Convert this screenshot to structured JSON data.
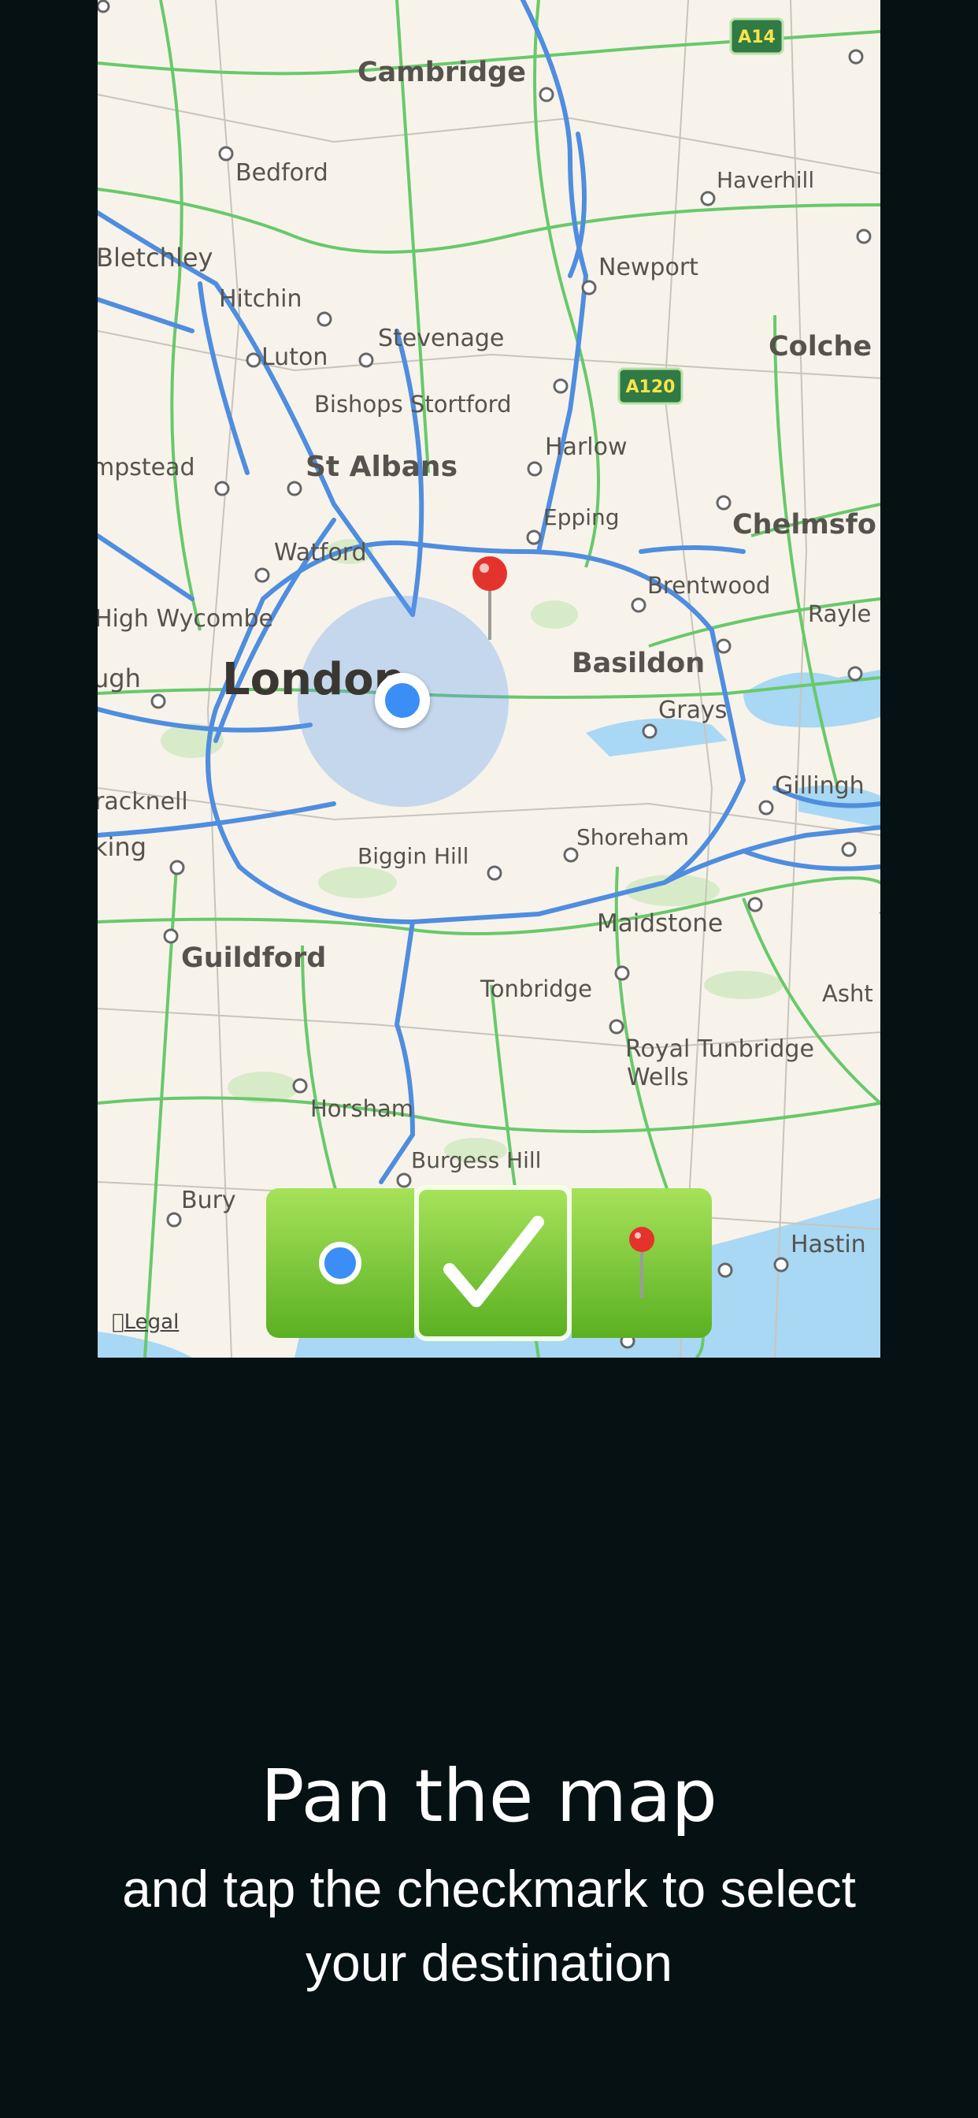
{
  "map": {
    "legal_label": "Legal",
    "cities_large": [
      "London"
    ],
    "cities_medium": [
      "Cambridge",
      "St Albans",
      "Chelmsfo",
      "Basildon",
      "Guildford",
      "Colche"
    ],
    "cities_small": [
      "Bedford",
      "Haverhill",
      "Bletchley",
      "Newport",
      "Hitchin",
      "Stevenage",
      "Luton",
      "Bishops Stortford",
      "Harlow",
      "mpstead",
      "Epping",
      "Watford",
      "Brentwood",
      "Rayle",
      "High Wycombe",
      "ugh",
      "Grays",
      "racknell",
      "Gillingh",
      "king",
      "Shoreham",
      "Biggin Hill",
      "Maidstone",
      "Tonbridge",
      "Asht",
      "Royal Tunbridge",
      "Wells",
      "Horsham",
      "Burgess Hill",
      "Bury",
      "Hastin"
    ],
    "road_shields": [
      "A14",
      "A120"
    ],
    "colors": {
      "road_motorway": "#4f8ddf",
      "road_primary": "#68c96a",
      "water": "#a8d8f4",
      "land": "#f7f3ea",
      "accuracy_circle": "#5d9af0",
      "pin": "#e4332d"
    }
  },
  "buttons": {
    "current_location_icon": "location-dot-icon",
    "confirm_icon": "checkmark-icon",
    "pin_icon": "map-pin-icon"
  },
  "caption": {
    "title": "Pan the map",
    "subtitle_line1": "and tap the checkmark to select",
    "subtitle_line2": "your destination"
  }
}
